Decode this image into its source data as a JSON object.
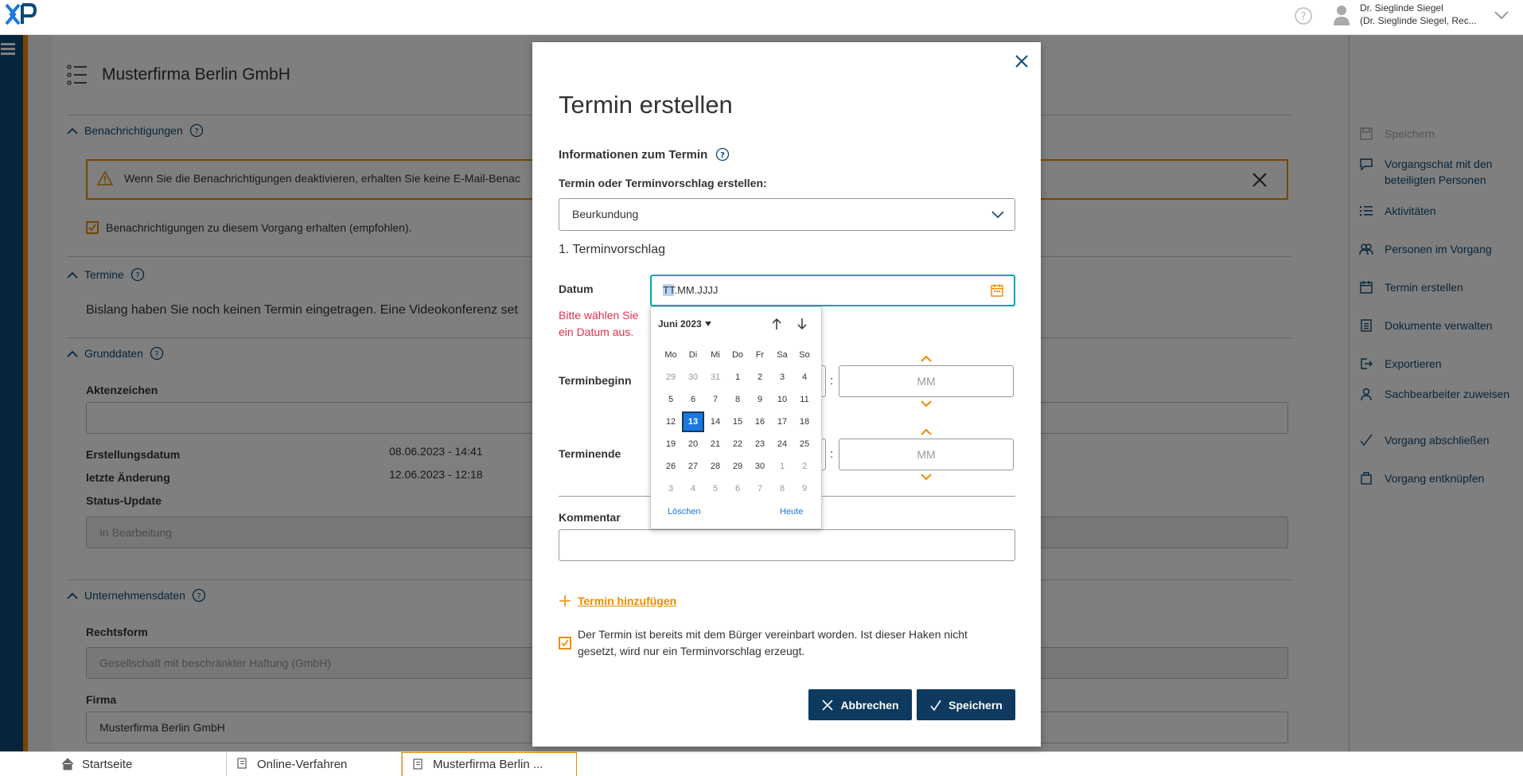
{
  "topbar": {
    "user_line1": "Dr. Sieglinde Siegel",
    "user_line2": "(Dr. Sieglinde Siegel, Rec..."
  },
  "main": {
    "title": "Musterfirma Berlin GmbH",
    "sections": {
      "notifications": {
        "title": "Benachrichtigungen",
        "warning": "Wenn Sie die Benachrichtigungen deaktivieren, erhalten Sie keine E-Mail-Benac",
        "checkbox_label": "Benachrichtigungen zu diesem Vorgang erhalten (empfohlen)."
      },
      "appointments": {
        "title": "Termine",
        "text": "Bislang haben Sie noch keinen Termin eingetragen. Eine Videokonferenz set"
      },
      "basic": {
        "title": "Grunddaten",
        "aktenzeichen_label": "Aktenzeichen",
        "created_label": "Erstellungsdatum",
        "created_value": "08.06.2023 - 14:41",
        "changed_label": "letzte Änderung",
        "changed_value": "12.06.2023 - 12:18",
        "status_label": "Status-Update",
        "status_value": "In Bearbeitung"
      },
      "company": {
        "title": "Unternehmensdaten",
        "legal_form_label": "Rechtsform",
        "legal_form_value": "Gesellschaft mit beschränkter Haftung (GmbH)",
        "firm_label": "Firma",
        "firm_value": "Musterfirma Berlin GmbH"
      }
    }
  },
  "rightpanel": {
    "items": [
      {
        "label": "Speichern",
        "icon": "save-icon"
      },
      {
        "label": "Vorgangschat mit den beteiligten Personen",
        "icon": "chat-icon"
      },
      {
        "label": "Aktivitäten",
        "icon": "list-icon"
      },
      {
        "label": "Personen im Vorgang",
        "icon": "people-icon"
      },
      {
        "label": "Termin erstellen",
        "icon": "calendar-icon"
      },
      {
        "label": "Dokumente verwalten",
        "icon": "documents-icon"
      },
      {
        "label": "Exportieren",
        "icon": "export-icon"
      },
      {
        "label": "Sachbearbeiter zuweisen",
        "icon": "person-icon"
      },
      {
        "label": "Vorgang abschließen",
        "icon": "check-icon"
      },
      {
        "label": "Vorgang entknüpfen",
        "icon": "unlink-icon"
      }
    ]
  },
  "tabs": [
    {
      "label": "Startseite"
    },
    {
      "label": "Online-Verfahren"
    },
    {
      "label": "Musterfirma Berlin ..."
    }
  ],
  "modal": {
    "title": "Termin erstellen",
    "subtitle": "Informationen zum Termin",
    "type_label": "Termin oder Terminvorschlag erstellen:",
    "type_value": "Beurkundung",
    "proposal_heading": "1. Terminvorschlag",
    "date_label": "Datum",
    "date_placeholder_hl": "TT",
    "date_placeholder_rest": ".MM.JJJJ",
    "error_line1": "Bitte wählen Sie",
    "error_line2": "ein Datum aus.",
    "start_label": "Terminbeginn",
    "end_label": "Terminende",
    "minute_placeholder": "MM",
    "colon": ":",
    "comment_label": "Kommentar",
    "add_link": "Termin hinzufügen",
    "agree_text": "Der Termin ist bereits mit dem Bürger vereinbart worden. Ist dieser Haken nicht gesetzt, wird nur ein Terminvorschlag erzeugt.",
    "cancel_label": "Abbrechen",
    "save_label": "Speichern"
  },
  "calendar": {
    "month_label": "Juni 2023",
    "weekdays": [
      "Mo",
      "Di",
      "Mi",
      "Do",
      "Fr",
      "Sa",
      "So"
    ],
    "weeks": [
      [
        {
          "d": "29",
          "m": true
        },
        {
          "d": "30",
          "m": true
        },
        {
          "d": "31",
          "m": true
        },
        {
          "d": "1"
        },
        {
          "d": "2"
        },
        {
          "d": "3"
        },
        {
          "d": "4"
        }
      ],
      [
        {
          "d": "5"
        },
        {
          "d": "6"
        },
        {
          "d": "7"
        },
        {
          "d": "8"
        },
        {
          "d": "9"
        },
        {
          "d": "10"
        },
        {
          "d": "11"
        }
      ],
      [
        {
          "d": "12"
        },
        {
          "d": "13",
          "s": true
        },
        {
          "d": "14"
        },
        {
          "d": "15"
        },
        {
          "d": "16"
        },
        {
          "d": "17"
        },
        {
          "d": "18"
        }
      ],
      [
        {
          "d": "19"
        },
        {
          "d": "20"
        },
        {
          "d": "21"
        },
        {
          "d": "22"
        },
        {
          "d": "23"
        },
        {
          "d": "24"
        },
        {
          "d": "25"
        }
      ],
      [
        {
          "d": "26"
        },
        {
          "d": "27"
        },
        {
          "d": "28"
        },
        {
          "d": "29"
        },
        {
          "d": "30"
        },
        {
          "d": "1",
          "m": true
        },
        {
          "d": "2",
          "m": true
        }
      ],
      [
        {
          "d": "3",
          "m": true
        },
        {
          "d": "4",
          "m": true
        },
        {
          "d": "5",
          "m": true
        },
        {
          "d": "6",
          "m": true
        },
        {
          "d": "7",
          "m": true
        },
        {
          "d": "8",
          "m": true
        },
        {
          "d": "9",
          "m": true
        }
      ]
    ],
    "clear_label": "Löschen",
    "today_label": "Heute"
  },
  "colors": {
    "brand_blue": "#0d4a78",
    "accent_orange": "#f08a00",
    "error_red": "#e0304e",
    "selected_blue": "#1a78e0",
    "focus_teal": "#00a4b4"
  }
}
